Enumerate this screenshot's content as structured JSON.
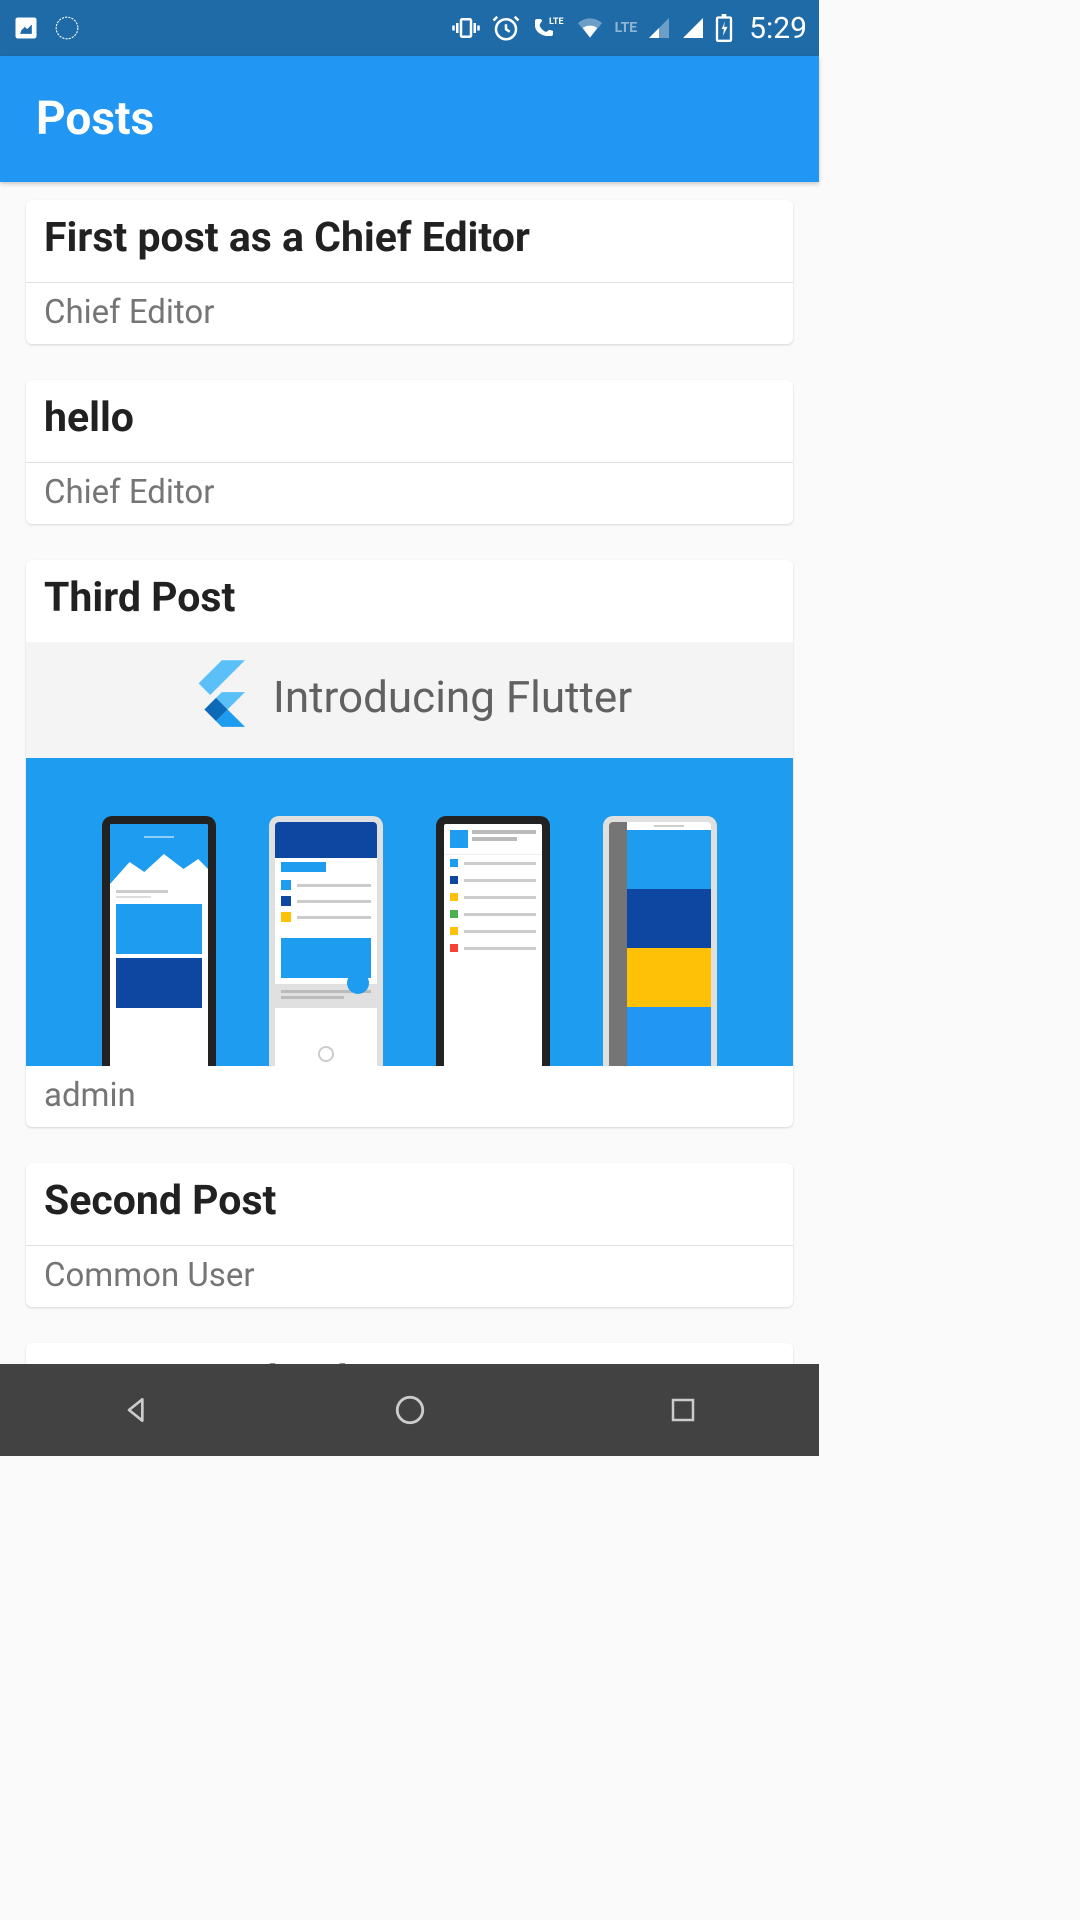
{
  "status": {
    "time": "5:29",
    "lte_label": "LTE"
  },
  "app_bar": {
    "title": "Posts"
  },
  "posts": [
    {
      "title": "First post as a Chief Editor",
      "author": "Chief Editor",
      "has_image": false
    },
    {
      "title": "hello",
      "author": "Chief Editor",
      "has_image": false
    },
    {
      "title": "Third Post",
      "author": "admin",
      "has_image": true,
      "image_caption": "Introducing Flutter"
    },
    {
      "title": "Second Post",
      "author": "Common User",
      "has_image": false
    },
    {
      "title": "First Post Edited",
      "author": "",
      "has_image": false
    }
  ]
}
